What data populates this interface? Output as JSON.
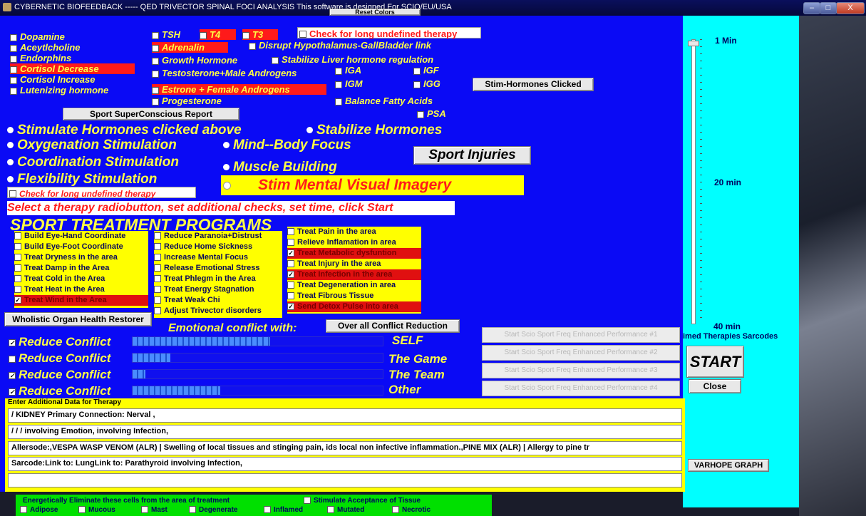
{
  "window": {
    "title": "CYBERNETIC BIOFEEDBACK  ----- QED   TRIVECTOR SPINAL FOCI ANALYSIS   This software is designed For SCIO/EU/USA",
    "reset_colors": "Reset Colors",
    "min_label": "–",
    "max_label": "□",
    "close_label": "X"
  },
  "hormones": {
    "col1": [
      {
        "label": "Dopamine",
        "red": false
      },
      {
        "label": "Aceytlcholine",
        "red": false
      },
      {
        "label": "Endorphins",
        "red": false
      },
      {
        "label": "Cortisol Decrease",
        "red": true
      },
      {
        "label": "Cortisol Increase",
        "red": false
      },
      {
        "label": "Lutenizing hormone",
        "red": false
      }
    ],
    "tsh": "TSH",
    "t4": "T4",
    "t3": "T3",
    "check_long_top": "Check for long undefined therapy",
    "adrenalin": "Adrenalin",
    "disrupt": "Disrupt Hypothalamus-GallBladder link",
    "growth": "Growth Hormone",
    "stabilize_liver": "Stabilize Liver hormone regulation",
    "testosterone": "Testosterone+Male Androgens",
    "iga": "IGA",
    "igf": "IGF",
    "estrone": "Estrone + Female Androgens",
    "igm": "IGM",
    "igg": "IGG",
    "progesterone": "Progesterone",
    "balance": "Balance Fatty Acids",
    "psa": "PSA",
    "stim_clicked_btn": "Stim-Hormones Clicked",
    "sport_report_btn": "Sport SuperConscious Report"
  },
  "radios": {
    "stimulate": "Stimulate Hormones clicked above",
    "stabilize": "Stabilize Hormones",
    "oxygenation": "Oxygenation Stimulation",
    "mind_body": "Mind--Body Focus",
    "coordination": "Coordination Stimulation",
    "muscle": "Muscle Building",
    "flexibility": "Flexibility  Stimulation",
    "mental_imagery": "Stim Mental Visual Imagery",
    "sport_injuries": "Sport Injuries",
    "check_long_bottom": "Check for long undefined therapy"
  },
  "instruction": "Select a therapy radiobutton, set additional checks, set time, click Start",
  "programs_heading": "SPORT TREATMENT PROGRAMS",
  "programs": {
    "col1": [
      {
        "label": "Build Eye-Hand Coordinate",
        "checked": false,
        "red": false
      },
      {
        "label": "Build Eye-Foot Coordinate",
        "checked": false,
        "red": false
      },
      {
        "label": "Treat Dryness in the area",
        "checked": false,
        "red": false
      },
      {
        "label": "Treat Damp in the Area",
        "checked": false,
        "red": false
      },
      {
        "label": "Treat Cold in the Area",
        "checked": false,
        "red": false
      },
      {
        "label": "Treat Heat in the Area",
        "checked": false,
        "red": false
      },
      {
        "label": "Treat Wind in the Area",
        "checked": true,
        "red": true
      }
    ],
    "col2": [
      {
        "label": "Reduce Paranoia+Distrust",
        "checked": false,
        "red": false
      },
      {
        "label": "Reduce Home Sickness",
        "checked": false,
        "red": false
      },
      {
        "label": "Increase Mental Focus",
        "checked": false,
        "red": false
      },
      {
        "label": "Release Emotional Stress",
        "checked": false,
        "red": false
      },
      {
        "label": "Treat  Phlegm in the Area",
        "checked": false,
        "red": false
      },
      {
        "label": "Treat Energy Stagnation",
        "checked": false,
        "red": false
      },
      {
        "label": "Treat Weak Chi",
        "checked": false,
        "red": false
      },
      {
        "label": "Adjust Trivector disorders",
        "checked": false,
        "red": false
      }
    ],
    "col3": [
      {
        "label": "Treat Pain in the area",
        "checked": false,
        "red": false
      },
      {
        "label": "Relieve Inflamation in area",
        "checked": false,
        "red": false
      },
      {
        "label": "Treat Metabolic dysfuntion",
        "checked": true,
        "red": true
      },
      {
        "label": "Treat Injury in the area",
        "checked": false,
        "red": false
      },
      {
        "label": "Treat Infection in the area",
        "checked": true,
        "red": true
      },
      {
        "label": "Treat Degeneration in area",
        "checked": false,
        "red": false
      },
      {
        "label": "Treat Fibrous Tissue",
        "checked": false,
        "red": false
      },
      {
        "label": "Send Detox Pulse into area",
        "checked": true,
        "red": true
      }
    ]
  },
  "wholistic_btn": "Wholistic Organ Health Restorer",
  "emotional_label": "Emotional conflict with:",
  "overall_btn": "Over all Conflict Reduction",
  "conflicts": [
    {
      "label": "Reduce Conflict",
      "checked": true,
      "target": "SELF",
      "level": 0.55
    },
    {
      "label": "Reduce Conflict",
      "checked": false,
      "target": "The Game",
      "level": 0.15
    },
    {
      "label": "Reduce Conflict",
      "checked": true,
      "target": "The Team",
      "level": 0.05
    },
    {
      "label": "Reduce Conflict",
      "checked": true,
      "target": "Other",
      "level": 0.35
    }
  ],
  "perf_buttons": [
    "Start Scio Sport Freq Enhanced Performance #1",
    "Start Scio Sport Freq Enhanced Performance #2",
    "Start Scio Sport Freq Enhanced Performance #3",
    "Start Scio Sport Freq Enhanced Performance #4"
  ],
  "additional": {
    "legend": "Enter Additional Data for Therapy",
    "lines": [
      "/ KIDNEY Primary Connection: Nerval ,",
      "/ / /  involving Emotion, involving Infection,",
      "Allersode:,VESPA WASP VENOM (ALR) | Swelling of local tissues and stinging pain, ids local non infective inflammation.,PINE MIX (ALR) | Allergy to pine tr",
      "Sarcode:Link to: LungLink to: Parathyroid involving Infection,",
      ""
    ]
  },
  "right_panel": {
    "min1": "1 Min",
    "min20": "20 min",
    "min40": "40 min",
    "timed": "imed Therapies Sarcodes",
    "start": "START",
    "close": "Close",
    "varhope": "VARHOPE GRAPH",
    "slider_level": 0.0
  },
  "bottom": {
    "eliminate": "Energetically Eliminate these cells from the area of treatment",
    "acceptance": "Stimulate Acceptance of Tissue",
    "cells": [
      "Adipose",
      "Mucous",
      "Mast",
      "Degenerate",
      "Inflamed",
      "Mutated",
      "Necrotic"
    ]
  },
  "colors": {
    "main_bg": "#0a0af5",
    "side_bg": "#00ffff",
    "accent_yellow": "#ffff44",
    "accent_red": "#ff1a1a"
  }
}
